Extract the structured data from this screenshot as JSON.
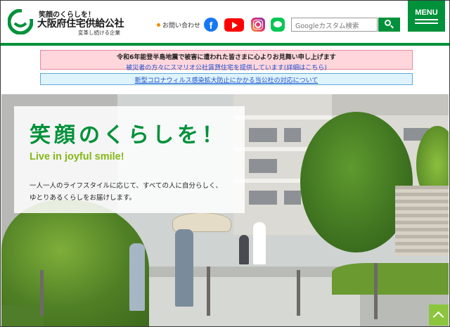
{
  "header": {
    "logo_tagline": "笑顔のくらしを！",
    "logo_name": "大阪府住宅供給公社",
    "logo_sub": "変革し続ける企業",
    "contact_label": "お問い合わせ",
    "social": [
      "facebook-icon",
      "youtube-icon",
      "instagram-icon",
      "line-icon"
    ],
    "facebook_glyph": "f",
    "search_placeholder": "Googleカスタム検索",
    "menu_label": "MENU"
  },
  "notices": {
    "earthquake_line1": "令和6年能登半島地震で被害に遭われた皆さまに心よりお見舞い申し上げます",
    "earthquake_line2": "被災者の方々にスマリオ公社賃貸住宅を提供しています(詳細はこちら)",
    "covid": "新型コロナウィルス感染拡大防止にかかる当公社の対応について"
  },
  "hero": {
    "title": "笑顔のくらしを！",
    "subtitle": "Live in joyful smile!",
    "body_line1": "一人一人のライフスタイルに応じて、すべての人に自分らしく、",
    "body_line2": "ゆとりあるくらしをお届けします。"
  },
  "colors": {
    "brand_green": "#00913a",
    "accent_lime": "#86b817",
    "notice_pink": "#ffd6dc",
    "notice_blue": "#dff3fb"
  }
}
